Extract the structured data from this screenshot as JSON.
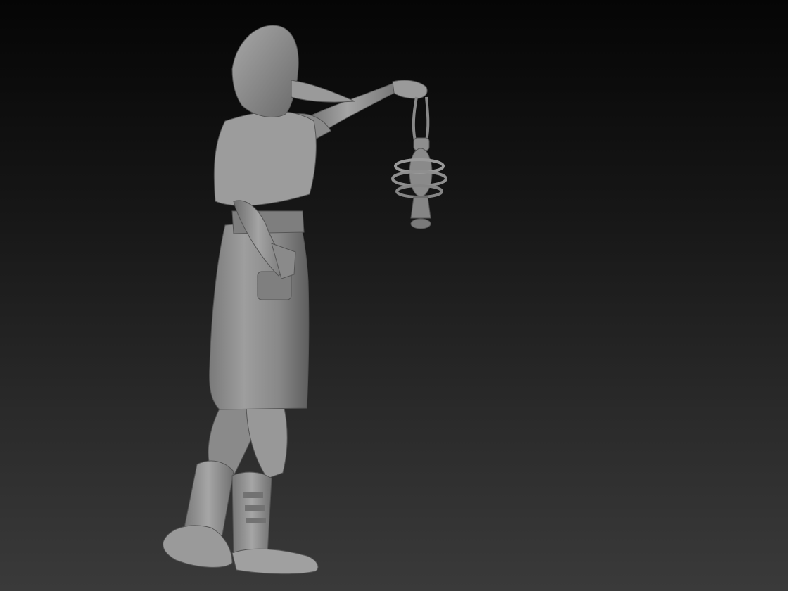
{
  "scene": {
    "subject": "plague-doctor-sculpt",
    "background_top_color": "#050505",
    "background_bottom_color": "#3a3a3a",
    "model_base_color": "#8c8c8c",
    "model_shadow_color": "#4a4a4a",
    "model_highlight_color": "#b4b4b4"
  }
}
